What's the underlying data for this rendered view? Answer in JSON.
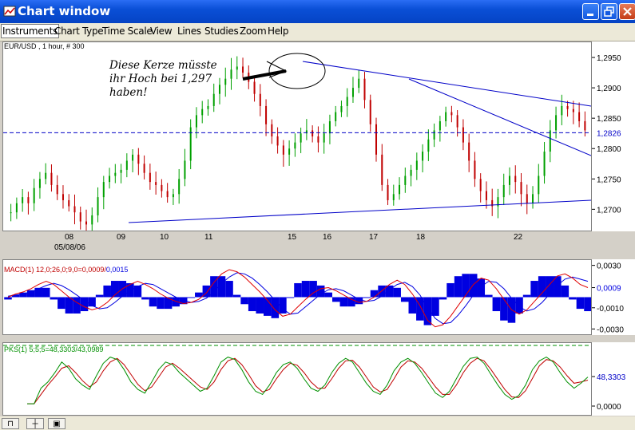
{
  "window": {
    "title": "Chart window"
  },
  "menu": [
    "Instruments",
    "Chart Type",
    "Time Scale",
    "View",
    "Lines",
    "Studies",
    "Zoom",
    "Help"
  ],
  "price_panel": {
    "symbol_label": "EUR/USD , 1 hour, # 300",
    "current_price": "1,2826",
    "annotation": [
      "Diese Kerze müsste",
      "ihr Hoch bei 1,297",
      "haben!"
    ],
    "y_ticks": [
      "1,2950",
      "1,2900",
      "1,2850",
      "1,2800",
      "1,2750",
      "1,2700"
    ],
    "x_ticks": [
      "08",
      "09",
      "10",
      "11",
      "15",
      "16",
      "17",
      "18",
      "22"
    ],
    "date_label": "05/08/06"
  },
  "macd_panel": {
    "label": "MACD(1) 12,0;26,0;9,0=0,0009/",
    "label_value2": "0,0015",
    "y_ticks": [
      "0,0030",
      "0,0009",
      "-0,0010",
      "-0,0030"
    ]
  },
  "pks_panel": {
    "label": "PKS(1) 5;5;5=48,3303/43,0989",
    "y_ticks": [
      "48,3303",
      "0,0000"
    ]
  },
  "colors": {
    "up_candle": "#00a000",
    "down_candle": "#c00000",
    "trend_line": "#0000c8",
    "macd_line": "#e00000",
    "signal_line": "#0000e0",
    "pks_k": "#009000",
    "pks_d": "#c00000"
  },
  "chart_data": [
    {
      "type": "candlestick",
      "title": "EUR/USD , 1 hour, # 300",
      "ylim": [
        1.2665,
        1.2975
      ],
      "x_labels": [
        "08",
        "09",
        "10",
        "11",
        "15",
        "16",
        "17",
        "18",
        "22"
      ],
      "current_value": 1.2826,
      "close_trace": [
        1.2695,
        1.271,
        1.272,
        1.271,
        1.2735,
        1.275,
        1.276,
        1.274,
        1.2725,
        1.2715,
        1.2705,
        1.2695,
        1.268,
        1.2675,
        1.269,
        1.272,
        1.2745,
        1.2755,
        1.276,
        1.2765,
        1.278,
        1.279,
        1.2775,
        1.276,
        1.2745,
        1.274,
        1.273,
        1.272,
        1.2725,
        1.275,
        1.278,
        1.2835,
        1.2855,
        1.2865,
        1.287,
        1.289,
        1.2905,
        1.2915,
        1.293,
        1.2935,
        1.2925,
        1.291,
        1.289,
        1.287,
        1.284,
        1.282,
        1.2805,
        1.279,
        1.28,
        1.281,
        1.2825,
        1.283,
        1.282,
        1.281,
        1.2825,
        1.2845,
        1.286,
        1.287,
        1.2885,
        1.29,
        1.2915,
        1.288,
        1.284,
        1.279,
        1.274,
        1.2715,
        1.2725,
        1.274,
        1.2755,
        1.2765,
        1.278,
        1.2795,
        1.2815,
        1.283,
        1.2845,
        1.286,
        1.2855,
        1.2835,
        1.281,
        1.278,
        1.275,
        1.273,
        1.2715,
        1.2705,
        1.272,
        1.274,
        1.2755,
        1.2745,
        1.2725,
        1.271,
        1.2725,
        1.2755,
        1.2795,
        1.283,
        1.2855,
        1.287,
        1.2865,
        1.286,
        1.2845,
        1.283
      ]
    },
    {
      "type": "line",
      "title": "MACD(1) 12,0;26,0;9,0=0,0009/0,0015",
      "ylim": [
        -0.0035,
        0.0035
      ],
      "series": [
        {
          "name": "macd",
          "values": [
            0.0,
            0.0003,
            0.0005,
            0.0008,
            0.0012,
            0.0015,
            0.0012,
            0.0006,
            0.0,
            -0.0005,
            -0.0009,
            -0.0012,
            -0.001,
            -0.0005,
            0.0002,
            0.0008,
            0.0012,
            0.0015,
            0.0012,
            0.0008,
            0.0003,
            -0.0001,
            -0.0004,
            -0.0006,
            -0.0005,
            -0.0002,
            0.0004,
            0.0014,
            0.0022,
            0.0026,
            0.0024,
            0.0019,
            0.0012,
            0.0005,
            -0.0003,
            -0.0012,
            -0.0018,
            -0.0016,
            -0.0009,
            -0.0002,
            0.0004,
            0.0008,
            0.0009,
            0.0006,
            0.0002,
            -0.0002,
            -0.0005,
            -0.0004,
            0.0,
            0.0006,
            0.0012,
            0.0016,
            0.0012,
            0.0003,
            -0.0008,
            -0.0022,
            -0.0028,
            -0.0026,
            -0.0018,
            -0.0008,
            0.0002,
            0.0012,
            0.0018,
            0.0016,
            0.0008,
            -0.0002,
            -0.0012,
            -0.0016,
            -0.0012,
            -0.0004,
            0.0004,
            0.0012,
            0.002,
            0.0022,
            0.0018,
            0.0012,
            0.0009
          ]
        },
        {
          "name": "signal",
          "values": [
            0.0001,
            0.0002,
            0.0003,
            0.0005,
            0.0008,
            0.0011,
            0.0013,
            0.0011,
            0.0007,
            0.0002,
            -0.0003,
            -0.0008,
            -0.0011,
            -0.001,
            -0.0005,
            0.0001,
            0.0006,
            0.001,
            0.0013,
            0.0012,
            0.0008,
            0.0004,
            0.0,
            -0.0003,
            -0.0005,
            -0.0004,
            -0.0001,
            0.0005,
            0.0013,
            0.0019,
            0.0023,
            0.0022,
            0.0018,
            0.0012,
            0.0005,
            -0.0003,
            -0.0011,
            -0.0016,
            -0.0015,
            -0.0009,
            -0.0003,
            0.0003,
            0.0007,
            0.0008,
            0.0006,
            0.0002,
            -0.0002,
            -0.0004,
            -0.0003,
            0.0001,
            0.0007,
            0.0012,
            0.0014,
            0.001,
            0.0002,
            -0.001,
            -0.002,
            -0.0025,
            -0.0024,
            -0.0017,
            -0.0008,
            0.0002,
            0.001,
            0.0015,
            0.0014,
            0.0008,
            -0.0001,
            -0.0009,
            -0.0013,
            -0.0011,
            -0.0005,
            0.0003,
            0.0011,
            0.0017,
            0.0019,
            0.0017,
            0.0015
          ]
        }
      ]
    },
    {
      "type": "line",
      "title": "PKS(1) 5;5;5=48,3303/43,0989",
      "ylim": [
        0,
        100
      ],
      "series": [
        {
          "name": "k",
          "values": [
            5,
            5,
            30,
            40,
            55,
            72,
            62,
            45,
            35,
            28,
            50,
            70,
            80,
            76,
            60,
            40,
            28,
            22,
            40,
            60,
            72,
            68,
            55,
            45,
            35,
            25,
            30,
            50,
            72,
            80,
            76,
            60,
            40,
            25,
            20,
            35,
            55,
            68,
            72,
            62,
            45,
            30,
            25,
            35,
            55,
            70,
            78,
            72,
            55,
            38,
            25,
            20,
            35,
            58,
            72,
            78,
            70,
            55,
            38,
            22,
            15,
            25,
            45,
            65,
            78,
            80,
            70,
            52,
            35,
            20,
            12,
            18,
            35,
            60,
            74,
            80,
            72,
            55,
            40,
            30,
            38,
            48
          ]
        },
        {
          "name": "d",
          "values": [
            5,
            5,
            20,
            35,
            48,
            62,
            66,
            55,
            42,
            32,
            40,
            58,
            72,
            78,
            68,
            52,
            36,
            26,
            32,
            48,
            64,
            70,
            62,
            52,
            42,
            32,
            28,
            40,
            60,
            74,
            78,
            68,
            52,
            34,
            24,
            28,
            45,
            60,
            70,
            67,
            55,
            40,
            30,
            30,
            45,
            62,
            74,
            75,
            64,
            48,
            32,
            24,
            28,
            45,
            64,
            74,
            72,
            62,
            47,
            32,
            20,
            20,
            35,
            55,
            70,
            78,
            74,
            60,
            44,
            28,
            16,
            15,
            26,
            46,
            66,
            76,
            74,
            64,
            50,
            38,
            40,
            43
          ]
        }
      ]
    }
  ]
}
